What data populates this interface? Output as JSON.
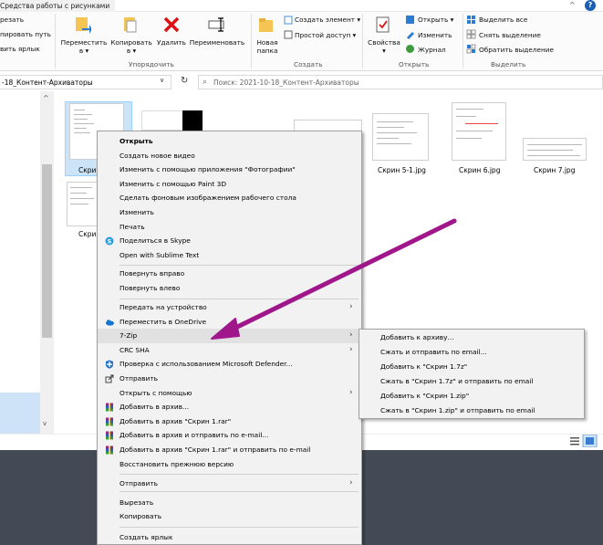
{
  "window": {
    "title_tab": "Средства работы с рисунками"
  },
  "ribbon": {
    "clipboard_partial": [
      "резать",
      "пировать путь",
      "вить ярлык"
    ],
    "move_to": "Переместить в",
    "copy_to": "Копировать в",
    "delete": "Удалить",
    "rename": "Переименовать",
    "group_organize": "Упорядочить",
    "new_folder": "Новая папка",
    "new_item": "Создать элемент",
    "easy_access": "Простой доступ",
    "group_create": "Создать",
    "properties": "Свойства",
    "open": "Открыть",
    "edit": "Изменить",
    "history": "Журнал",
    "group_open": "Открыть",
    "select_all": "Выделить все",
    "select_none": "Снять выделение",
    "invert_selection": "Обратить выделение",
    "group_select": "Выделить"
  },
  "address": {
    "path": "-18_Контент-Архиваторы",
    "search_placeholder": "Поиск: 2021-10-18_Контент-Архиваторы"
  },
  "files": [
    {
      "name": "Скрин 1.jpg",
      "visible_label": "Скри"
    },
    {
      "name": "Скрин 5-1.jpg"
    },
    {
      "name": "Скрин 6.jpg"
    },
    {
      "name": "Скрин 7.jpg"
    },
    {
      "name": "Скрин",
      "visible_label": "Скри"
    }
  ],
  "context_menu": {
    "items": [
      {
        "label": "Открыть",
        "bold": true
      },
      {
        "label": "Создать новое видео"
      },
      {
        "label": "Изменить с помощью приложения \"Фотографии\""
      },
      {
        "label": "Изменить с помощью Paint 3D"
      },
      {
        "label": "Сделать фоновым изображением рабочего стола"
      },
      {
        "label": "Изменить"
      },
      {
        "label": "Печать"
      },
      {
        "label": "Поделиться в Skype",
        "icon": "skype-icon"
      },
      {
        "label": "Open with Sublime Text"
      },
      {
        "label": "Повернуть вправо"
      },
      {
        "label": "Повернуть влево"
      },
      {
        "label": "Передать на устройство",
        "submenu": true
      },
      {
        "label": "Переместить в OneDrive",
        "icon": "onedrive-icon"
      },
      {
        "label": "7-Zip",
        "submenu": true
      },
      {
        "label": "CRC SHA",
        "submenu": true
      },
      {
        "label": "Проверка с использованием Microsoft Defender...",
        "icon": "defender-icon"
      },
      {
        "label": "Отправить",
        "icon": "share-icon"
      },
      {
        "label": "Открыть с помощью",
        "submenu": true
      },
      {
        "label": "Добавить в архив...",
        "icon": "winrar-icon"
      },
      {
        "label": "Добавить в архив \"Скрин 1.rar\"",
        "icon": "winrar-icon"
      },
      {
        "label": "Добавить в архив и отправить по e-mail...",
        "icon": "winrar-icon"
      },
      {
        "label": "Добавить в архив \"Скрин 1.rar\" и отправить по e-mail",
        "icon": "winrar-icon"
      },
      {
        "label": "Восстановить прежнюю версию"
      },
      {
        "label": "Отправить",
        "submenu": true
      },
      {
        "label": "Вырезать"
      },
      {
        "label": "Копировать"
      },
      {
        "label": "Создать ярлык"
      }
    ]
  },
  "zip_submenu": {
    "items": [
      "Добавить к архиву...",
      "Сжать и отправить по email...",
      "Добавить к \"Скрин 1.7z\"",
      "Сжать в \"Скрин 1.7z\" и отправить по email",
      "Добавить к \"Скрин 1.zip\"",
      "Сжать в \"Скрин 1.zip\" и отправить по email"
    ]
  },
  "colors": {
    "annotation_arrow": "#a0178c",
    "selection": "#cce4f7",
    "desktop": "#434a55"
  }
}
